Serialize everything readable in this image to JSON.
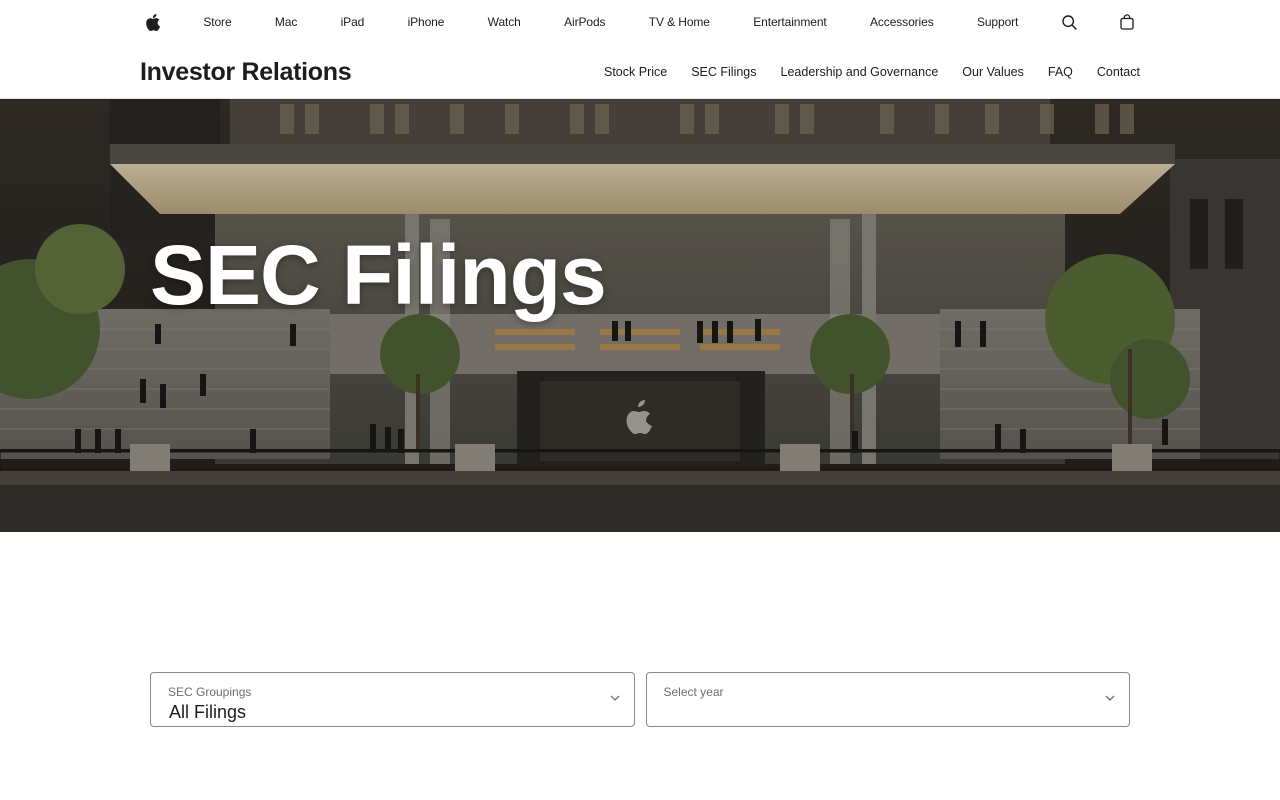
{
  "globalnav": {
    "items": [
      {
        "label": "Store"
      },
      {
        "label": "Mac"
      },
      {
        "label": "iPad"
      },
      {
        "label": "iPhone"
      },
      {
        "label": "Watch"
      },
      {
        "label": "AirPods"
      },
      {
        "label": "TV & Home"
      },
      {
        "label": "Entertainment"
      },
      {
        "label": "Accessories"
      },
      {
        "label": "Support"
      }
    ],
    "icons": [
      "apple-logo-icon",
      "search-icon",
      "shopping-bag-icon"
    ]
  },
  "localnav": {
    "title": "Investor Relations",
    "links": [
      {
        "label": "Stock Price"
      },
      {
        "label": "SEC Filings"
      },
      {
        "label": "Leadership and Governance"
      },
      {
        "label": "Our Values"
      },
      {
        "label": "FAQ"
      },
      {
        "label": "Contact"
      }
    ]
  },
  "hero": {
    "title": "SEC Filings"
  },
  "filters": {
    "groupings": {
      "label": "SEC Groupings",
      "value": "All Filings"
    },
    "year": {
      "label": "Select year",
      "value": ""
    }
  },
  "colors": {
    "text": "#1d1d1f",
    "border": "#86868b",
    "label": "#6e6e73",
    "hero_overlay": "#2b2a28"
  }
}
